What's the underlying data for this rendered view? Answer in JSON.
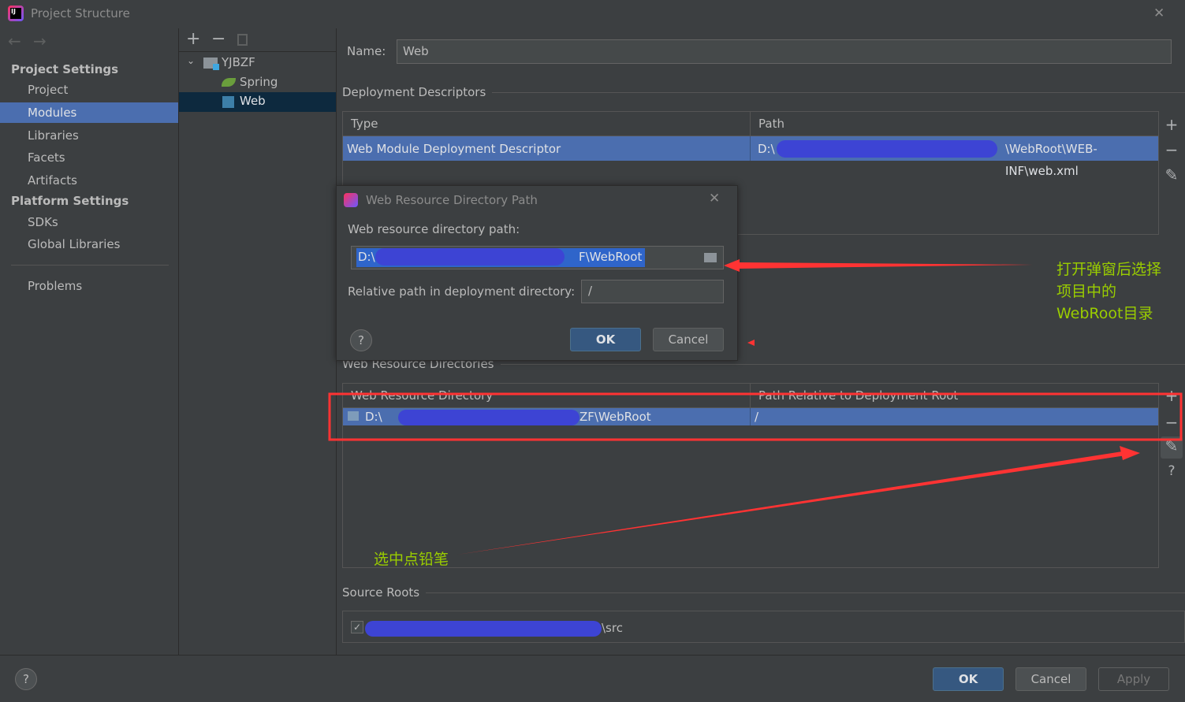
{
  "window": {
    "title": "Project Structure",
    "close": "✕"
  },
  "sidebar": {
    "nav_back": "←",
    "nav_forward": "→",
    "project_settings": "Project Settings",
    "items": [
      {
        "label": "Project"
      },
      {
        "label": "Modules",
        "selected": true
      },
      {
        "label": "Libraries"
      },
      {
        "label": "Facets"
      },
      {
        "label": "Artifacts"
      }
    ],
    "platform_settings": "Platform Settings",
    "platform_items": [
      {
        "label": "SDKs"
      },
      {
        "label": "Global Libraries"
      }
    ],
    "problems": "Problems"
  },
  "tree": {
    "add": "+",
    "remove": "−",
    "root": "YJBZF",
    "children": [
      {
        "label": "Spring"
      },
      {
        "label": "Web",
        "selected": true
      }
    ]
  },
  "main": {
    "name_label": "Name:",
    "name_value": "Web",
    "deployment_descriptors": "Deployment Descriptors",
    "dd_headers": [
      "Type",
      "Path"
    ],
    "dd_row": {
      "type": "Web Module Deployment Descriptor",
      "path_prefix": "D:\\",
      "path_suffix": "\\WebRoot\\WEB-INF\\web.xml"
    },
    "web_resource_directories": "Web Resource Directories",
    "wr_headers": [
      "Web Resource Directory",
      "Path Relative to Deployment Root"
    ],
    "wr_row": {
      "dir_prefix": "D:\\",
      "dir_suffix": "ZF\\WebRoot",
      "relative": "/"
    },
    "source_roots": "Source Roots",
    "source_row": {
      "suffix": "\\src",
      "checked": true
    }
  },
  "dialog": {
    "title": "Web Resource Directory Path",
    "path_label": "Web resource directory path:",
    "path_prefix": "D:\\",
    "path_suffix": "F\\WebRoot",
    "relative_label": "Relative path in deployment directory:",
    "relative_value": "/",
    "help": "?",
    "ok": "OK",
    "cancel": "Cancel"
  },
  "annotations": {
    "top_right": [
      "打开弹窗后选择",
      "项目中的",
      "WebRoot目录"
    ],
    "bottom": "选中点铅笔",
    "color": "#ff3333",
    "text_color": "#9acd00"
  },
  "footer": {
    "help": "?",
    "ok": "OK",
    "cancel": "Cancel",
    "apply": "Apply"
  },
  "colors": {
    "selection": "#4b6eaf",
    "tree_selection": "#0d293e",
    "scribble": "#3d44d4"
  }
}
